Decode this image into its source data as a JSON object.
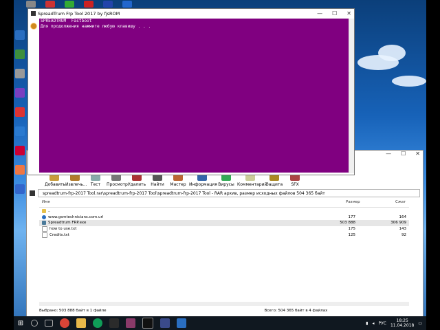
{
  "cmd_window": {
    "title": "SpreadTrum Frp Tool 2017 by fjsROM",
    "lines": [
      "SPREADTRUM  Fastboot",
      "Для продолжения нажмите любую клавишу . . ."
    ]
  },
  "rar_window": {
    "toolbar": [
      "Добавить",
      "Извлечь...",
      "Тест",
      "Просмотр",
      "Удалить",
      "Найти",
      "Мастер",
      "Информация",
      "Вирусы",
      "Комментарий",
      "Защита",
      "SFX"
    ],
    "path": "spreadtrum-frp-2017 Tool.rar\\spreadtrum-frp-2017 Tool\\spreadtrum-frp-2017 Tool - RAR архив, размер исходных файлов 504 365 байт",
    "columns": {
      "name": "Имя",
      "size": "Размер",
      "packed": "Сжат"
    },
    "rows": [
      {
        "name": "..",
        "size": "",
        "packed": ""
      },
      {
        "name": "www.gsmtechnicians.com.url",
        "size": "177",
        "packed": "164"
      },
      {
        "name": "Spreadtrum FRP.exe",
        "size": "503 888",
        "packed": "306 909"
      },
      {
        "name": "how to use.txt",
        "size": "175",
        "packed": "143"
      },
      {
        "name": "Credits.txt",
        "size": "125",
        "packed": "92"
      }
    ],
    "status_left": "Выбрано: 503 888 байт в 1 файле",
    "status_right": "Всего: 504 365 байт в 4 файлах"
  },
  "taskbar": {
    "lang": "РУС",
    "time": "18:25",
    "date": "11.04.2018"
  },
  "colors": {
    "console_bg": "#800080",
    "taskbar": "#101820"
  }
}
